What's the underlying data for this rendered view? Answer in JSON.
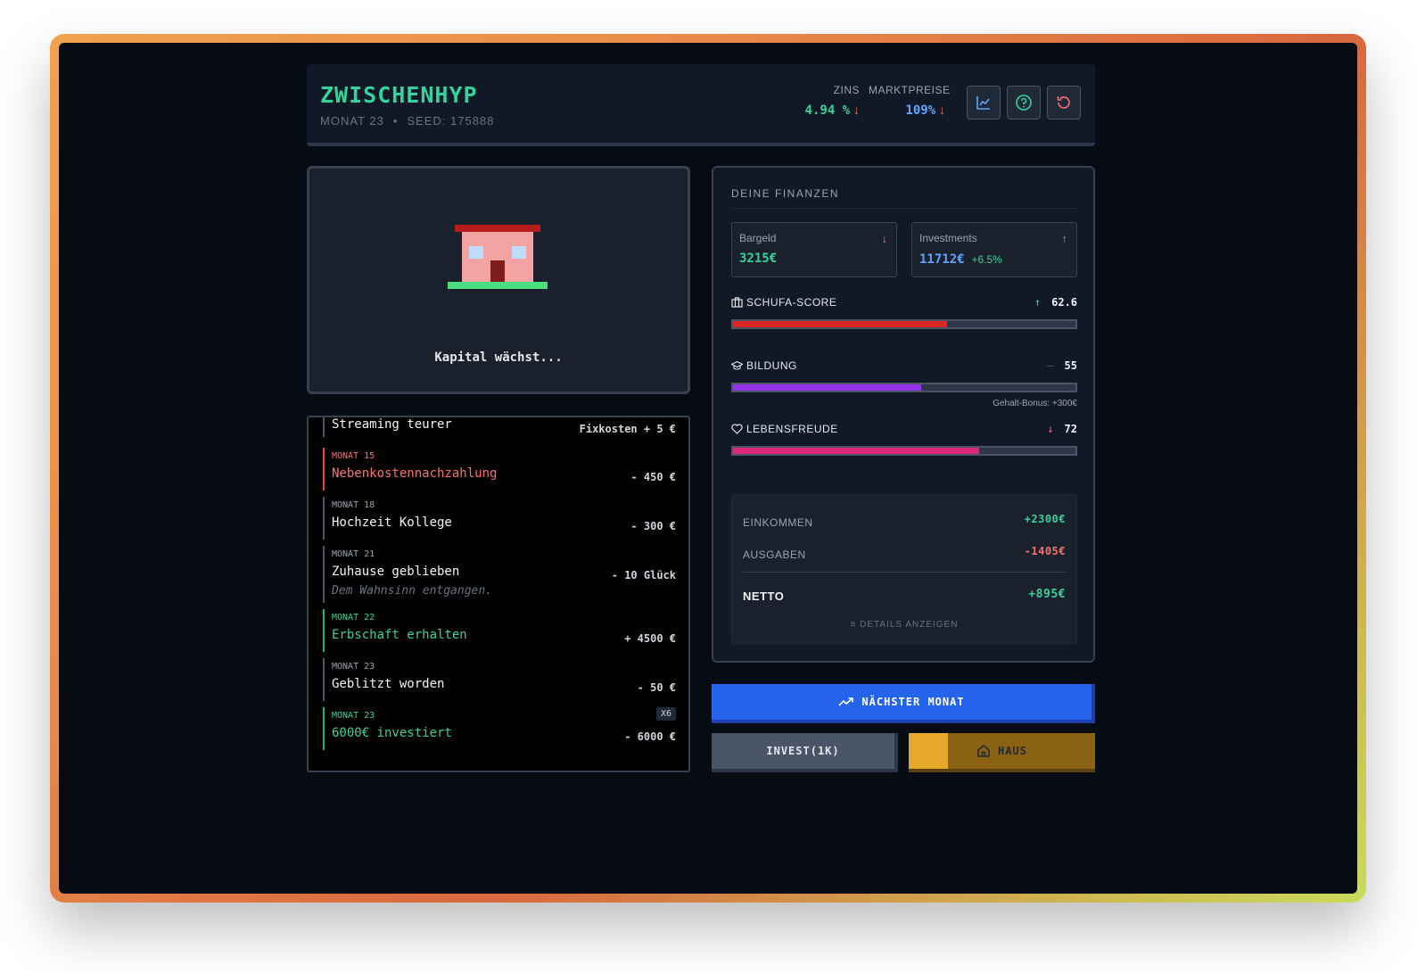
{
  "header": {
    "title": "ZWISCHENHYP",
    "month_label": "MONAT 23",
    "separator": "•",
    "seed_label": "SEED: 175888",
    "zins": {
      "label": "ZINS",
      "value": "4.94 %",
      "arrow": "↓"
    },
    "marktpreise": {
      "label": "MARKTPREISE",
      "value": "109%",
      "arrow": "↓"
    },
    "buttons": [
      "chart-icon",
      "help-icon",
      "reset-icon"
    ]
  },
  "scene": {
    "caption": "Kapital wächst..."
  },
  "log": [
    {
      "month": "",
      "title": "Streaming teurer",
      "amount": "Fixkosten + 5 €",
      "tone": "neutral"
    },
    {
      "month": "MONAT 15",
      "title": "Nebenkostennachzahlung",
      "amount": "- 450 €",
      "tone": "red"
    },
    {
      "month": "MONAT 18",
      "title": "Hochzeit Kollege",
      "amount": "- 300 €",
      "tone": "neutral"
    },
    {
      "month": "MONAT 21",
      "title": "Zuhause geblieben",
      "amount": "- 10 Glück",
      "subtitle": "Dem Wahnsinn entgangen.",
      "tone": "neutral"
    },
    {
      "month": "MONAT 22",
      "title": "Erbschaft erhalten",
      "amount": "+ 4500 €",
      "tone": "green"
    },
    {
      "month": "MONAT 23",
      "title": "Geblitzt worden",
      "amount": "- 50 €",
      "tone": "neutral"
    },
    {
      "month": "MONAT 23",
      "title": "6000€ investiert",
      "amount": "- 6000 €",
      "badge": "X6",
      "tone": "green"
    }
  ],
  "finance": {
    "title": "DEINE FINANZEN",
    "cash": {
      "label": "Bargeld",
      "value": "3215€",
      "arrow": "↓"
    },
    "investments": {
      "label": "Investments",
      "value": "11712€",
      "change": "+6.5%",
      "arrow": "↑"
    },
    "schufa": {
      "label": "SCHUFA-SCORE",
      "value": "62.6",
      "arrow": "↑",
      "fill": 0.626,
      "color": "#dc2626"
    },
    "bildung": {
      "label": "BILDUNG",
      "value": "55",
      "arrow": "—",
      "fill": 0.55,
      "color": "#9333ea",
      "note": "Gehalt-Bonus: +300€"
    },
    "lebensfreude": {
      "label": "LEBENSFREUDE",
      "value": "72",
      "arrow": "↓",
      "fill": 0.72,
      "color": "#db2777"
    },
    "summary": {
      "income_label": "EINKOMMEN",
      "income_value": "+2300€",
      "expenses_label": "AUSGABEN",
      "expenses_value": "-1405€",
      "net_label": "NETTO",
      "net_value": "+895€",
      "details_label": "DETAILS ANZEIGEN"
    }
  },
  "actions": {
    "next_label": "NÄCHSTER MONAT",
    "invest_label": "INVEST(1K)",
    "house_label": "HAUS",
    "house_progress": 0.21
  },
  "colors": {
    "accent_green": "#34d399",
    "accent_blue": "#60a5fa",
    "accent_red": "#f87171",
    "panel": "#111827"
  }
}
